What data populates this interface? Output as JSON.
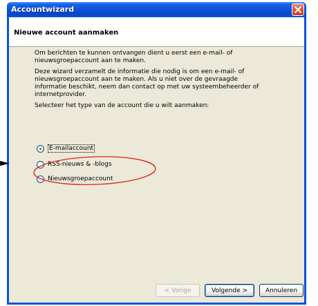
{
  "window": {
    "title": "Accountwizard"
  },
  "page": {
    "heading": "Nieuwe account aanmaken"
  },
  "intro": [
    "Om berichten te kunnen ontvangen dient u eerst een e-mail- of nieuwsgroepaccount aan te maken.",
    "Deze wizard verzamelt de informatie die nodig is om een e-mail- of nieuwsgroepaccount aan te maken. Als u niet over de gevraagde informatie beschikt, neem dan contact op met uw systeembeheerder of internetprovider.",
    "Selecteer het type van de account die u wilt aanmaken:"
  ],
  "options": [
    {
      "label": "E-mailaccount",
      "selected": true
    },
    {
      "label": "RSS-nieuws & -blogs",
      "selected": false
    },
    {
      "label": "Nieuwsgroepaccount",
      "selected": false
    }
  ],
  "buttons": {
    "back": "< Vorige",
    "next": "Volgende >",
    "cancel": "Annuleren"
  },
  "colors": {
    "titlebar": "#0a53d8",
    "dialog_bg": "#ece9d8",
    "annotation": "#e0201a"
  }
}
